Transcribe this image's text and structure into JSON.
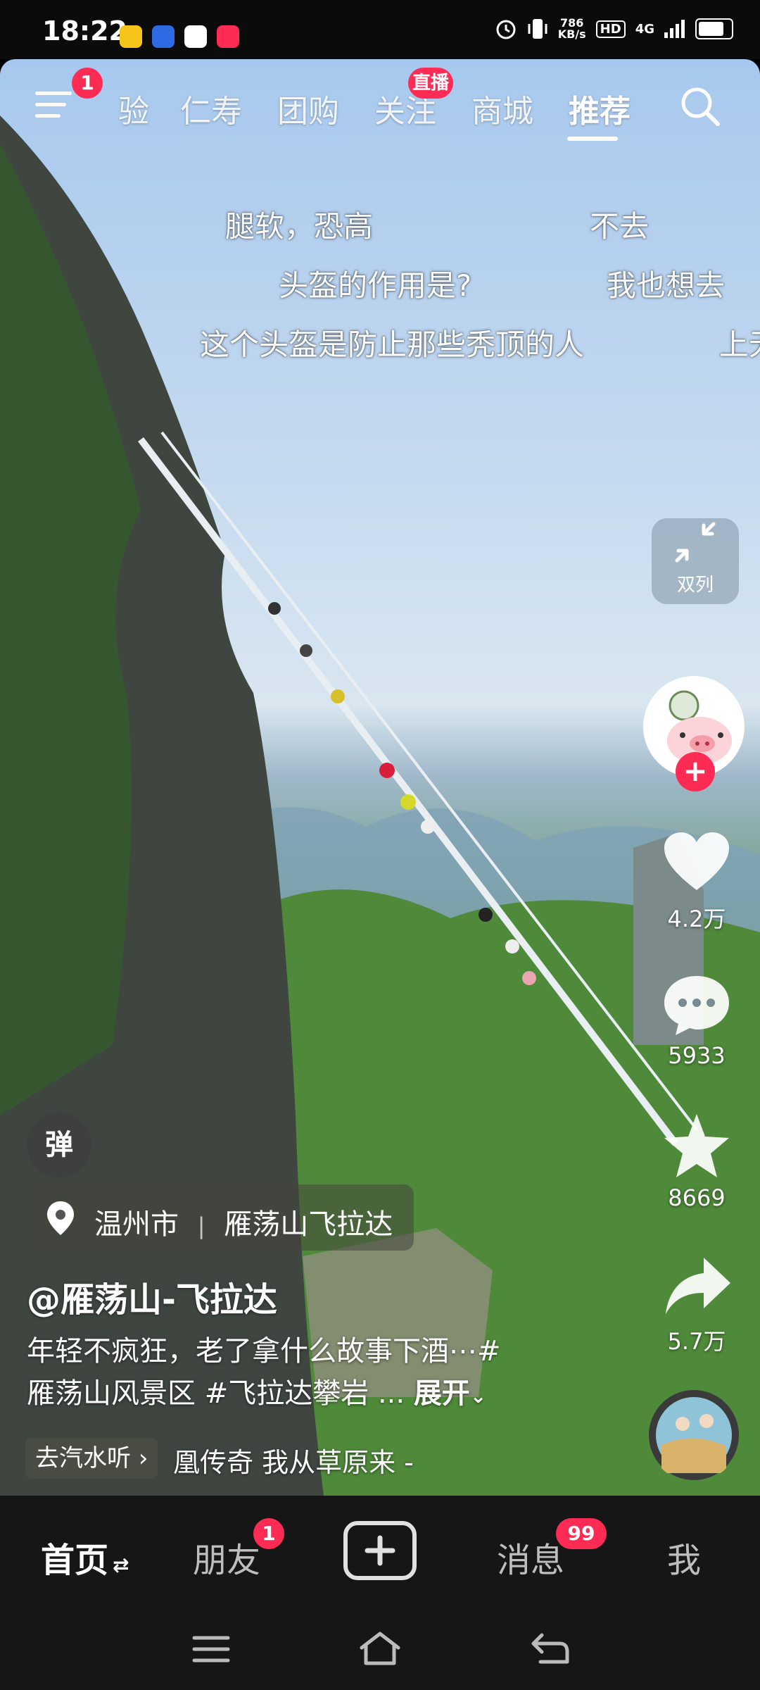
{
  "status_bar": {
    "time": "18:22",
    "net_speed_value": "786",
    "net_speed_unit": "KB/s",
    "hd": "HD",
    "network": "4G"
  },
  "top_tabs": {
    "menu_badge": "1",
    "tabs": [
      "验",
      "仁寿",
      "团购",
      "关注",
      "商城",
      "推荐"
    ],
    "live_badge": "直播",
    "active_tab": "推荐"
  },
  "danmaku": [
    "腿软，恐高",
    "不去",
    "头盔的作用是?",
    "我也想去",
    "这个头盔是防止那些秃顶的人",
    "上无"
  ],
  "video_actions": {
    "collapse_label": "双列",
    "likes": "4.2万",
    "comments": "5933",
    "favorites": "8669",
    "shares": "5.7万"
  },
  "danmu_toggle": "弹",
  "location": {
    "city": "温州市",
    "separator": "|",
    "place": "雁荡山飞拉达"
  },
  "post": {
    "author": "@雁荡山-飞拉达",
    "desc_line1": "年轻不疯狂，老了拿什么故事下酒⋯#",
    "desc_line2": "雁荡山风景区 #飞拉达攀岩 ...",
    "expand_label": "展开"
  },
  "music": {
    "tag_label": "去汽水听",
    "title": "凰传奇    我从草原来 -"
  },
  "bottom_nav": {
    "home": "首页",
    "friends": "朋友",
    "friends_badge": "1",
    "messages": "消息",
    "messages_badge": "99",
    "me": "我"
  },
  "colors": {
    "accent_red": "#fe2c55",
    "nav_bg": "#161616"
  }
}
